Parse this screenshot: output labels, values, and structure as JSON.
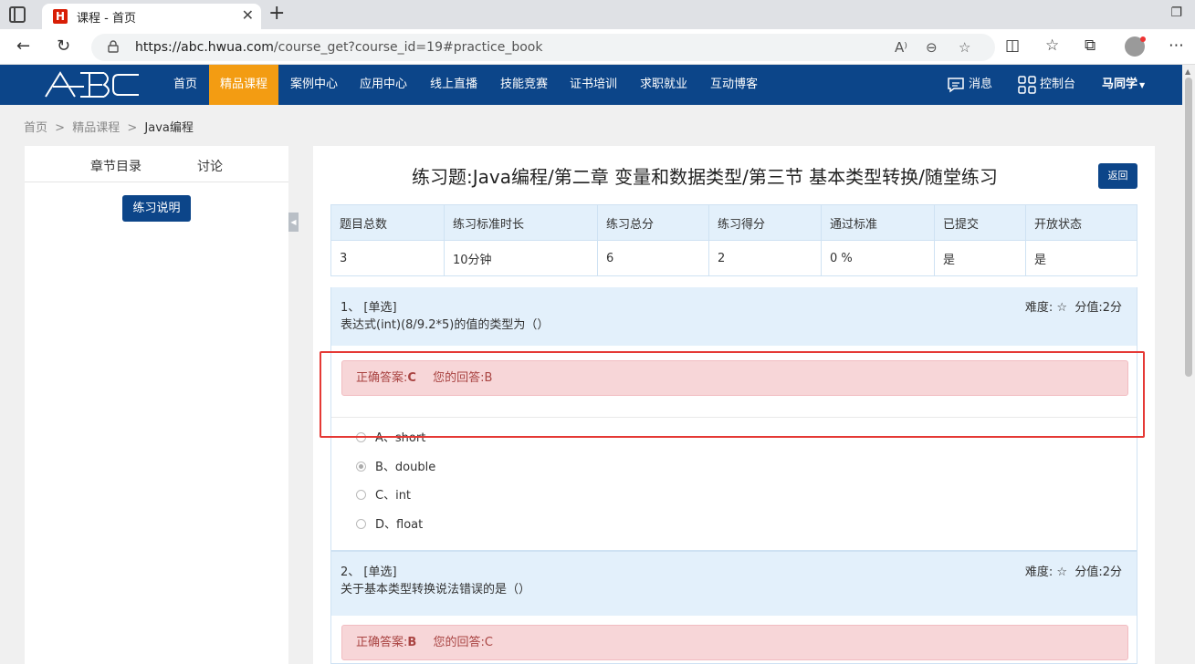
{
  "browser": {
    "tab_title": "课程 - 首页",
    "url_host": "https://abc.hwua.com",
    "url_path": "/course_get?course_id=19#practice_book"
  },
  "nav": {
    "logo": "ABC",
    "items": [
      "首页",
      "精品课程",
      "案例中心",
      "应用中心",
      "线上直播",
      "技能竞赛",
      "证书培训",
      "求职就业",
      "互动博客"
    ],
    "active_index": 1,
    "messages": "消息",
    "console": "控制台",
    "user": "马同学"
  },
  "breadcrumb": {
    "home": "首页",
    "sep": ">",
    "course": "精品课程",
    "current": "Java编程"
  },
  "left": {
    "tab_chapters": "章节目录",
    "tab_discuss": "讨论",
    "btn_instructions": "练习说明"
  },
  "main": {
    "title": "练习题:Java编程/第二章 变量和数据类型/第三节 基本类型转换/随堂练习",
    "back": "返回",
    "stats_headers": [
      "题目总数",
      "练习标准时长",
      "练习总分",
      "练习得分",
      "通过标准",
      "已提交",
      "开放状态"
    ],
    "stats_values": [
      "3",
      "10分钟",
      "6",
      "2",
      "0 %",
      "是",
      "是"
    ]
  },
  "questions": [
    {
      "number": "1、 [单选]",
      "text": "表达式(int)(8/9.2*5)的值的类型为（）",
      "difficulty_label": "难度:",
      "difficulty_star": "☆",
      "score_label": "分值:",
      "score": "2分",
      "correct_label": "正确答案:",
      "correct": "C",
      "yours_label": "您的回答:",
      "yours": "B",
      "options": [
        "A、short",
        "B、double",
        "C、int",
        "D、float"
      ],
      "selected_index": 1
    },
    {
      "number": "2、 [单选]",
      "text": "关于基本类型转换说法错误的是（）",
      "difficulty_label": "难度:",
      "difficulty_star": "☆",
      "score_label": "分值:",
      "score": "2分",
      "correct_label": "正确答案:",
      "correct": "B",
      "yours_label": "您的回答:",
      "yours": "C"
    }
  ]
}
